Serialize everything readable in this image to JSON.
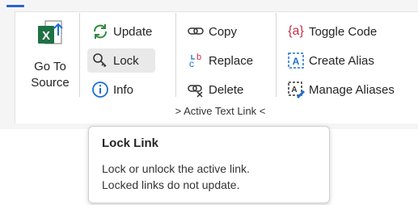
{
  "ribbon": {
    "group_label": "> Active Text Link <",
    "go_to_source": {
      "label_line1": "Go To",
      "label_line2": "Source",
      "icon": "excel-arrow-icon"
    },
    "update": {
      "label": "Update",
      "icon": "refresh-icon"
    },
    "lock": {
      "label": "Lock",
      "icon": "lock-icon"
    },
    "info": {
      "label": "Info",
      "icon": "info-icon"
    },
    "copy": {
      "label": "Copy",
      "icon": "link-copy-icon"
    },
    "replace": {
      "label": "Replace",
      "icon": "replace-icon"
    },
    "delete": {
      "label": "Delete",
      "icon": "link-delete-icon"
    },
    "toggle_code": {
      "label": "Toggle Code",
      "icon": "code-braces-icon",
      "glyph": "{a}"
    },
    "create_alias": {
      "label": "Create Alias",
      "icon": "alias-icon",
      "glyph": "A"
    },
    "manage_aliases": {
      "label": "Manage Aliases",
      "icon": "manage-aliases-icon",
      "glyph": "A"
    }
  },
  "tooltip": {
    "title": "Lock Link",
    "line1": "Lock or unlock the active link.",
    "line2": "Locked links do not update."
  },
  "colors": {
    "accent": "#2b63c9",
    "excel_green": "#1e7145",
    "update_green": "#2e8b3e",
    "info_blue": "#1a6fd6",
    "toggle_red": "#c4314b"
  }
}
